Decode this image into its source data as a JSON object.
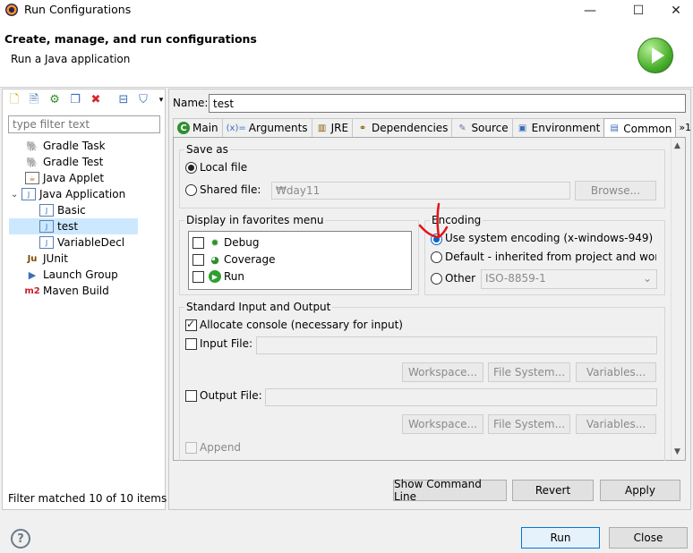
{
  "window": {
    "title": "Run Configurations",
    "minimize_glyph": "—",
    "maximize_glyph": "☐",
    "close_glyph": "✕"
  },
  "header": {
    "title": "Create, manage, and run configurations",
    "subtitle": "Run a Java application"
  },
  "left": {
    "filter_placeholder": "type filter text",
    "tree": [
      {
        "label": "Gradle Task",
        "icon": "gradle-elephant-icon"
      },
      {
        "label": "Gradle Test",
        "icon": "gradle-elephant-icon"
      },
      {
        "label": "Java Applet",
        "icon": "java-applet-icon"
      },
      {
        "label": "Java Application",
        "icon": "java-application-icon",
        "expanded": true
      },
      {
        "label": "Basic",
        "icon": "java-class-icon"
      },
      {
        "label": "test",
        "icon": "java-class-icon",
        "selected": true
      },
      {
        "label": "VariableDecl",
        "icon": "java-class-icon"
      },
      {
        "label": "JUnit",
        "icon": "junit-icon",
        "icon_text": "Ju"
      },
      {
        "label": "Launch Group",
        "icon": "launch-group-icon"
      },
      {
        "label": "Maven Build",
        "icon": "maven-icon",
        "icon_text": "m2"
      }
    ],
    "status": "Filter matched 10 of 10 items"
  },
  "name": {
    "label": "Name:",
    "value": "test"
  },
  "tabs": [
    {
      "label": "Main"
    },
    {
      "label": "Arguments",
      "icon_text": "(x)="
    },
    {
      "label": "JRE"
    },
    {
      "label": "Dependencies"
    },
    {
      "label": "Source"
    },
    {
      "label": "Environment"
    },
    {
      "label": "Common",
      "active": true
    },
    {
      "label": "»1"
    }
  ],
  "common": {
    "save_as": {
      "title": "Save as",
      "local_file": "Local file",
      "shared_file": "Shared file:",
      "shared_file_value": "₩day11",
      "browse": "Browse..."
    },
    "favorites": {
      "title": "Display in favorites menu",
      "items": [
        "Debug",
        "Coverage",
        "Run"
      ]
    },
    "encoding": {
      "title": "Encoding",
      "system": "Use system encoding (x-windows-949)",
      "default": "Default - inherited from project and worksp",
      "other": "Other",
      "other_value": "ISO-8859-1"
    },
    "stdio": {
      "title": "Standard Input and Output",
      "allocate_console": "Allocate console (necessary for input)",
      "input_file": "Input File:",
      "output_file": "Output File:",
      "workspace": "Workspace...",
      "file_system": "File System...",
      "variables": "Variables...",
      "append": "Append"
    }
  },
  "actions": {
    "show_command_line": "Show Command Line",
    "revert": "Revert",
    "apply": "Apply",
    "run": "Run",
    "close": "Close",
    "help": "?"
  },
  "colors": {
    "selection": "#cce8ff",
    "annotation_red": "#e0151b",
    "run_green": "#4ab02c"
  }
}
